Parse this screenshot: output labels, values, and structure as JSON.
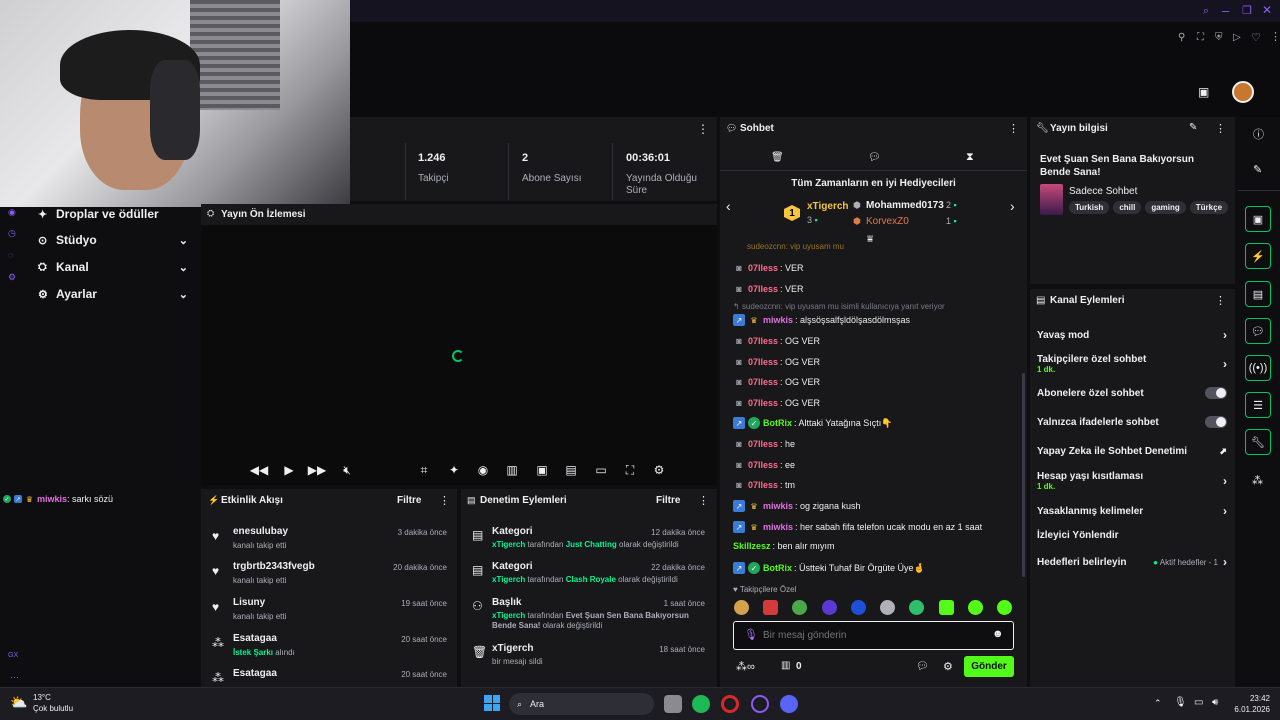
{
  "sidebar": {
    "items": [
      {
        "label": "Droplar ve ödüller"
      },
      {
        "label": "Stüdyo"
      },
      {
        "label": "Kanal"
      },
      {
        "label": "Ayarlar"
      }
    ],
    "chat_overlay": {
      "user": "miwkis",
      "message": ": sarkı sözü"
    },
    "gx_label": "GX"
  },
  "stats": [
    {
      "value": "1.246",
      "label": "Takipçi"
    },
    {
      "value": "2",
      "label": "Abone Sayısı"
    },
    {
      "value": "00:36:01",
      "label": "Yayında Olduğu Süre"
    }
  ],
  "preview": {
    "title": "Yayın Ön İzlemesi"
  },
  "activity": {
    "title": "Etkinlik Akışı",
    "filter": "Filtre",
    "items": [
      {
        "name": "enesulubay",
        "sub": "kanalı takip etti",
        "time": "3 dakika önce"
      },
      {
        "name": "trgbrtb2343fvegb",
        "sub": "kanalı takip etti",
        "time": "20 dakika önce"
      },
      {
        "name": "Lisuny",
        "sub": "kanalı takip etti",
        "time": "19 saat önce"
      },
      {
        "name": "Esatagaa",
        "sub_green": "İstek Şarkı",
        "sub": " alındı",
        "time": "20 saat önce"
      },
      {
        "name": "Esatagaa",
        "time": "20 saat önce"
      }
    ]
  },
  "moderation": {
    "title": "Denetim Eylemleri",
    "filter": "Filtre",
    "items": [
      {
        "name": "Kategori",
        "time": "12 dakika önce",
        "by": "xTigerch",
        "mid": " tarafından ",
        "value": "Just Chatting",
        "end": " olarak değiştirildi"
      },
      {
        "name": "Kategori",
        "time": "22 dakika önce",
        "by": "xTigerch",
        "mid": " tarafından ",
        "value": "Clash Royale",
        "end": " olarak değiştirildi"
      },
      {
        "name": "Başlık",
        "time": "1 saat önce",
        "by": "xTigerch",
        "mid": " tarafından ",
        "value": "Evet Şuan Sen Bana Bakıyorsun Bende Sana!",
        "end": " olarak değiştirildi"
      },
      {
        "name": "xTigerch",
        "time": "18 saat önce",
        "sub": "bir mesajı sildi"
      }
    ]
  },
  "chat": {
    "title": "Sohbet",
    "gifters_title": "Tüm Zamanların en iyi Hediyecileri",
    "top_gifter": {
      "rank": "1",
      "name": "xTigerch",
      "count": "3"
    },
    "gifters": [
      {
        "name": "Mohammed0173",
        "count": "2"
      },
      {
        "name": "KorvexZ0",
        "count": "1"
      }
    ],
    "partial_line": "sudeozcnn: vip uyusam mu",
    "reply_line": "sudeozcnn: vip uyusam mu isimli kullanıcıya yanıt veriyor",
    "messages": [
      {
        "user": "07lless",
        "text": ": VER"
      },
      {
        "user": "07lless",
        "text": ": VER"
      },
      {
        "user": "miwkis",
        "text": ": alşsöşsalfşldölşasdölmsşas"
      },
      {
        "user": "07lless",
        "text": ": OG VER"
      },
      {
        "user": "07lless",
        "text": ": OG VER"
      },
      {
        "user": "07lless",
        "text": ": OG VER"
      },
      {
        "user": "07lless",
        "text": ": OG VER"
      },
      {
        "user": "BotRix",
        "text": ": Alttaki Yatağına Sıçtı👇"
      },
      {
        "user": "07lless",
        "text": ": he"
      },
      {
        "user": "07lless",
        "text": ": ee"
      },
      {
        "user": "07lless",
        "text": ": tm"
      },
      {
        "user": "miwkis",
        "text": ": og zigana kush"
      },
      {
        "user": "miwkis",
        "text": ": her sabah fifa telefon ucak modu en az 1 saat"
      },
      {
        "user": "Skillzesz",
        "text": ": ben alır mıyım"
      },
      {
        "user": "BotRix",
        "text": ": Üstteki Tuhaf Bir Örgüte Üye🤞"
      }
    ],
    "followers_only": "Takipçilere Özel",
    "input_placeholder": "Bir mesaj gönderin",
    "points": "0",
    "send": "Gönder"
  },
  "stream_info": {
    "title": "Yayın bilgisi",
    "stream_title": "Evet Şuan Sen Bana Bakıyorsun Bende Sana!",
    "category": "Sadece Sohbet",
    "tags": [
      "Turkish",
      "chill",
      "gaming",
      "Türkçe"
    ]
  },
  "channel_actions": {
    "title": "Kanal Eylemleri",
    "rows": [
      {
        "label": "Yavaş mod"
      },
      {
        "label": "Takipçilere özel sohbet",
        "sub": "1 dk."
      },
      {
        "label": "Abonelere özel sohbet"
      },
      {
        "label": "Yalnızca ifadelerle sohbet"
      },
      {
        "label": "Yapay Zeka ile Sohbet Denetimi"
      },
      {
        "label": "Hesap yaşı kısıtlaması",
        "sub": "1 dk."
      },
      {
        "label": "Yasaklanmış kelimeler"
      },
      {
        "label": "İzleyici Yönlendir"
      },
      {
        "label": "Hedefleri belirleyin",
        "extra": "Aktif hedefler - 1"
      }
    ]
  },
  "taskbar": {
    "weather_temp": "13°C",
    "weather_desc": "Çok bulutlu",
    "search": "Ara",
    "time": "23:42",
    "date": "6.01.2026"
  },
  "colors": {
    "accent": "#53fc18",
    "bg": "#0e0e10",
    "panel": "#18181b"
  }
}
